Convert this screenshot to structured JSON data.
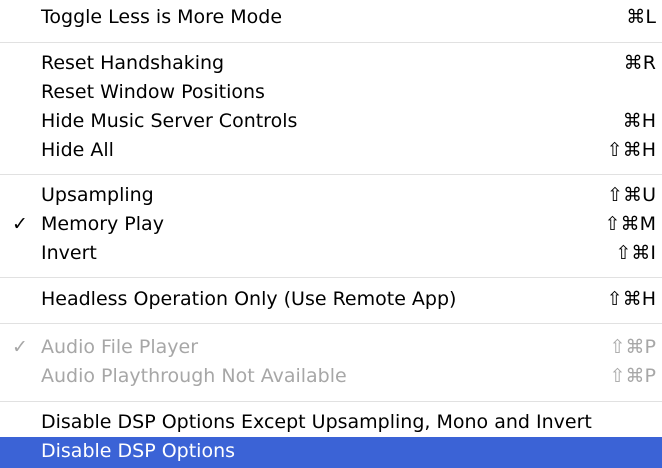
{
  "colors": {
    "highlight": "#3b63d6",
    "highlight_text": "#ffffff",
    "disabled_text": "#a7a7a7",
    "separator": "#e1e1e1"
  },
  "menu": {
    "groups": [
      {
        "items": [
          {
            "label": "Toggle Less is More Mode",
            "shortcut": "⌘L"
          }
        ]
      },
      {
        "items": [
          {
            "label": "Reset Handshaking",
            "shortcut": "⌘R"
          },
          {
            "label": "Reset Window Positions",
            "shortcut": ""
          },
          {
            "label": "Hide Music Server Controls",
            "shortcut": "⌘H"
          },
          {
            "label": "Hide All",
            "shortcut": "⇧⌘H"
          }
        ]
      },
      {
        "items": [
          {
            "label": "Upsampling",
            "shortcut": "⇧⌘U"
          },
          {
            "label": "Memory Play",
            "shortcut": "⇧⌘M",
            "check": "✓"
          },
          {
            "label": "Invert",
            "shortcut": "⇧⌘I"
          }
        ]
      },
      {
        "items": [
          {
            "label": "Headless Operation Only (Use Remote App)",
            "shortcut": "⇧⌘H"
          }
        ]
      },
      {
        "items": [
          {
            "label": "Audio File Player",
            "shortcut": "⇧⌘P",
            "check": "✓",
            "disabled": true
          },
          {
            "label": "Audio Playthrough Not Available",
            "shortcut": "⇧⌘P",
            "disabled": true
          }
        ]
      },
      {
        "items": [
          {
            "label": "Disable DSP Options Except Upsampling, Mono and Invert",
            "shortcut": ""
          },
          {
            "label": "Disable DSP Options",
            "shortcut": "",
            "highlighted": true
          }
        ]
      }
    ]
  }
}
